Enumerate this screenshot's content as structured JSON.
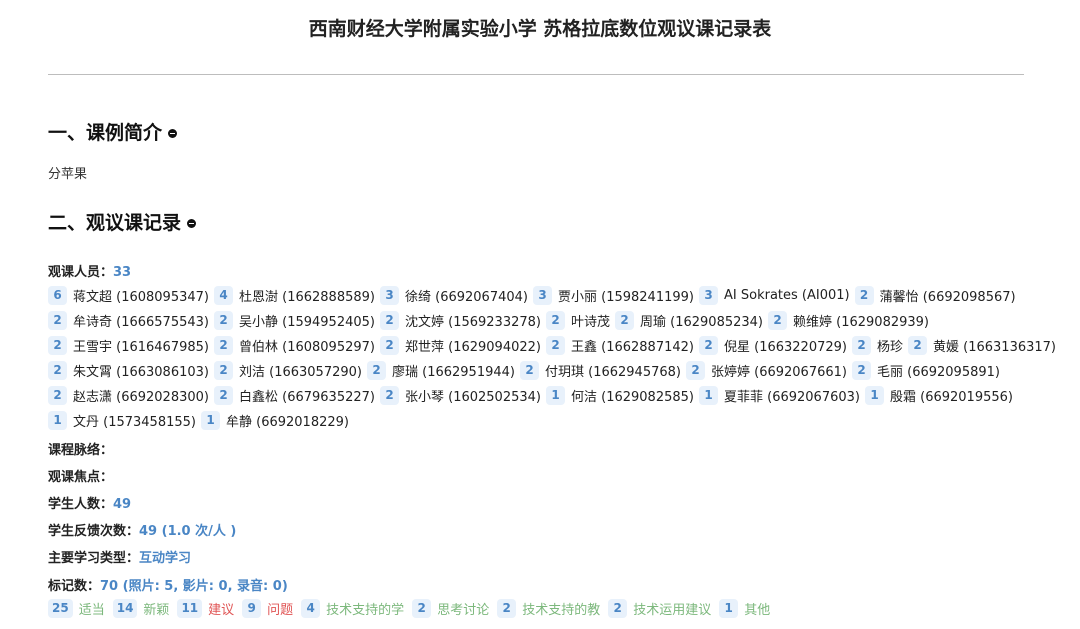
{
  "title": "西南财经大学附属实验小学 苏格拉底数位观议课记录表",
  "sections": [
    {
      "heading": "一、课例简介",
      "icon": "minus-circle-icon"
    },
    {
      "heading": "二、观议课记录",
      "icon": "minus-circle-icon"
    }
  ],
  "intro": "分苹果",
  "observers": {
    "label": "观课人员：",
    "count": "33",
    "rows": [
      [
        {
          "n": "6",
          "name": "蒋文超 (1608095347)"
        },
        {
          "n": "4",
          "name": "杜恩澍 (1662888589)"
        },
        {
          "n": "3",
          "name": "徐绮 (6692067404)"
        },
        {
          "n": "3",
          "name": "贾小丽 (1598241199)"
        },
        {
          "n": "3",
          "name": "AI Sokrates (AI001)"
        },
        {
          "n": "2",
          "name": "蒲馨怡 (6692098567)"
        }
      ],
      [
        {
          "n": "2",
          "name": "牟诗奇 (1666575543)"
        },
        {
          "n": "2",
          "name": "吴小静 (1594952405)"
        },
        {
          "n": "2",
          "name": "沈文婷 (1569233278)"
        },
        {
          "n": "2",
          "name": "叶诗茂"
        },
        {
          "n": "2",
          "name": "周瑜 (1629085234)"
        },
        {
          "n": "2",
          "name": "赖维婷 (1629082939)"
        }
      ],
      [
        {
          "n": "2",
          "name": "王雪宇 (1616467985)"
        },
        {
          "n": "2",
          "name": "曾伯林 (1608095297)"
        },
        {
          "n": "2",
          "name": "郑世萍 (1629094022)"
        },
        {
          "n": "2",
          "name": "王鑫 (1662887142)"
        },
        {
          "n": "2",
          "name": "倪星 (1663220729)"
        },
        {
          "n": "2",
          "name": "杨珍"
        },
        {
          "n": "2",
          "name": "黄媛 (1663136317)"
        }
      ],
      [
        {
          "n": "2",
          "name": "朱文霄 (1663086103)"
        },
        {
          "n": "2",
          "name": "刘洁 (1663057290)"
        },
        {
          "n": "2",
          "name": "廖瑞 (1662951944)"
        },
        {
          "n": "2",
          "name": "付玥琪 (1662945768)"
        },
        {
          "n": "2",
          "name": "张婷婷 (6692067661)"
        },
        {
          "n": "2",
          "name": "毛丽 (6692095891)"
        }
      ],
      [
        {
          "n": "2",
          "name": "赵志潇 (6692028300)"
        },
        {
          "n": "2",
          "name": "白鑫松 (6679635227)"
        },
        {
          "n": "2",
          "name": "张小琴 (1602502534)"
        },
        {
          "n": "1",
          "name": "何洁 (1629082585)"
        },
        {
          "n": "1",
          "name": "夏菲菲 (6692067603)"
        },
        {
          "n": "1",
          "name": "殷霜 (6692019556)"
        }
      ],
      [
        {
          "n": "1",
          "name": "文丹 (1573458155)"
        },
        {
          "n": "1",
          "name": "牟静 (6692018229)"
        }
      ]
    ]
  },
  "fields": {
    "course_context": {
      "label": "课程脉络：",
      "value": ""
    },
    "focus": {
      "label": "观课焦点：",
      "value": ""
    },
    "students": {
      "label": "学生人数：",
      "value": "49"
    },
    "feedback": {
      "label": "学生反馈次数：",
      "value": "49 (1.0 次/人 )"
    },
    "learning_type": {
      "label": "主要学习类型：",
      "value": "互动学习"
    },
    "markers": {
      "label": "标记数：",
      "value": "70 (照片: 5, 影片: 0, 录音: 0)"
    }
  },
  "tags": [
    {
      "n": "25",
      "label": "适当",
      "color": "#7cb87c"
    },
    {
      "n": "14",
      "label": "新颖",
      "color": "#7cb87c"
    },
    {
      "n": "11",
      "label": "建议",
      "color": "#e05555"
    },
    {
      "n": "9",
      "label": "问题",
      "color": "#e05555"
    },
    {
      "n": "4",
      "label": "技术支持的学",
      "color": "#7cb87c"
    },
    {
      "n": "2",
      "label": "思考讨论",
      "color": "#7cb87c"
    },
    {
      "n": "2",
      "label": "技术支持的教",
      "color": "#7cb87c"
    },
    {
      "n": "2",
      "label": "技术运用建议",
      "color": "#7cb87c"
    },
    {
      "n": "1",
      "label": "其他",
      "color": "#7cb87c"
    }
  ]
}
